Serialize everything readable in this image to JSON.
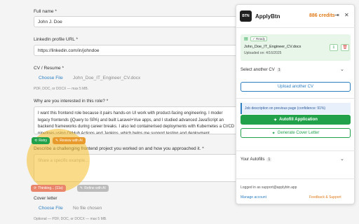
{
  "form": {
    "full_name_label": "Full name *",
    "full_name_value": "John J. Doe",
    "linkedin_label": "LinkedIn profile URL *",
    "linkedin_value": "https://linkedin.com/in/johndoe",
    "cv_label": "CV / Resume *",
    "cv_choose": "Choose File",
    "cv_file": "John_Doe_IT_Engineer_CV.docx",
    "cv_hint": "PDF, DOC, or DOCX — max 5 MB.",
    "why_label": "Why are you interested in this role? *",
    "why_text": "I want this frontend role because it pairs hands-on UI work with product-facing engineering. I moder legacy frontends (jQuery to SPA) and built Laravel+Vue apps, and I studied advanced JavaScript an backend frameworks during career breaks. I also led containerised deployments with Kubernetes a CI/CD pipelines using GitHub Actions and Jenkins, which helps me support testing and deployment",
    "retry": "Retry",
    "review_ai": "Review with AI",
    "challenge_label": "Describe a challenging frontend project you worked on and how you approached it. *",
    "challenge_placeholder": "Share a specific example...",
    "thinking": "Thinking... (11s)",
    "refine_ai": "Refine with AI",
    "cover_label": "Cover letter",
    "cover_choose": "Choose File",
    "cover_file": "No file chosen",
    "cover_hint": "Optional — PDF, DOC, or DOCX — max 5 MB."
  },
  "panel": {
    "logo": "BTN",
    "brand": "ApplyBtn",
    "credits": "886 credits",
    "ready": "✓ Ready",
    "cv_name": "John_Doe_IT_Engineer_CV.docx",
    "uploaded": "Uploaded on: 4/16/2025",
    "select_cv": "Select another CV",
    "select_cv_count": "1",
    "upload_btn": "Upload another CV",
    "job_desc": "Job description on previous page (confidence: 91%)",
    "autofill_btn": "Autofill Application",
    "cover_btn": "Generate Cover Letter",
    "your_autofills": "Your Autofills",
    "autofills_count": "1",
    "logged_in": "Logged in as support@applybtn.app",
    "manage_account": "Manage account",
    "feedback": "Feedback & Support"
  },
  "colors": {
    "accent": "#22a14b",
    "brand_orange": "#e07b1a",
    "link": "#2d7fc1"
  }
}
